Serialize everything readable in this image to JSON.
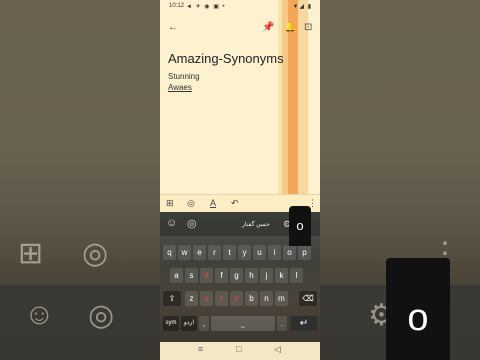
{
  "status": {
    "time": "10:12",
    "left_icons": "◄ ✈ ◉ ▣ •",
    "right_icons": "▼◢ ▮"
  },
  "toolbar": {
    "back_icon": "←",
    "pin_icon": "📌",
    "reminder_icon": "🔔",
    "archive_icon": "⊡"
  },
  "note": {
    "title": "Amazing-Synonyms",
    "lines": [
      "Stunning",
      "Awaes"
    ]
  },
  "edit_toolbar": {
    "add_icon": "⊞",
    "palette_icon": "◎",
    "text_format_icon": "A",
    "undo_icon": "↶",
    "more_icon": "⋮"
  },
  "keyboard": {
    "suggestions": {
      "emoji_icon": "☺",
      "palette_icon": "◎",
      "urdu_text": "حسن گفتار",
      "gear_icon": "⚙"
    },
    "popup_key": "o",
    "row1": [
      "q",
      "w",
      "e",
      "r",
      "t",
      "y",
      "u",
      "i",
      "o",
      "p"
    ],
    "row2": [
      "a",
      "s",
      "d",
      "f",
      "g",
      "h",
      "j",
      "k",
      "l"
    ],
    "row3": [
      "z",
      "x",
      "c",
      "v",
      "b",
      "n",
      "m"
    ],
    "shift_icon": "⇧",
    "backspace_icon": "⌫",
    "sym_label": "sym",
    "lang_label": "اردو",
    "comma": ",",
    "space_label": "⎵",
    "period": ".",
    "enter_icon": "↵"
  },
  "navbar": {
    "menu_icon": "≡",
    "home_icon": "□",
    "back_icon": "◁"
  },
  "backdrop": {
    "add_icon": "⊞",
    "palette_icon": "◎",
    "emoji_icon": "☺",
    "gear_icon": "⚙",
    "key_letter": "o"
  }
}
